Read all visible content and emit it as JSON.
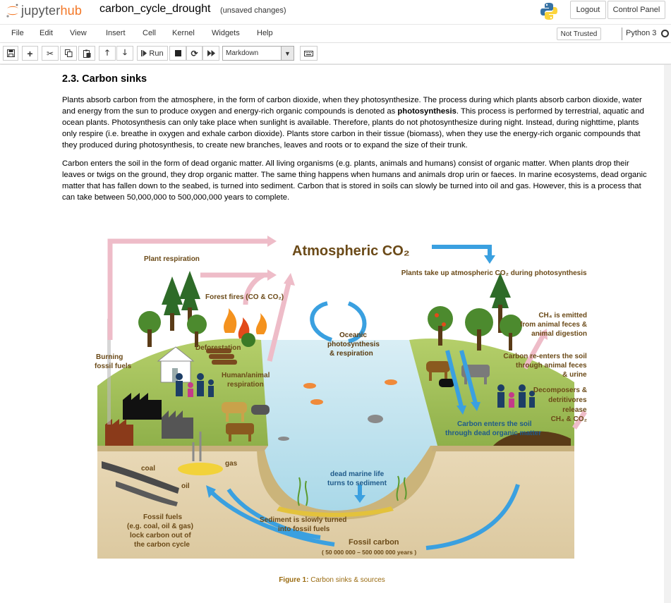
{
  "header": {
    "logo_prefix": "jupyter",
    "logo_suffix": "hub",
    "notebook_title": "carbon_cycle_drought",
    "save_status": "(unsaved changes)",
    "logout_label": "Logout",
    "control_panel_label": "Control Panel"
  },
  "menubar": {
    "items": [
      "File",
      "Edit",
      "View",
      "Insert",
      "Cell",
      "Kernel",
      "Widgets",
      "Help"
    ],
    "trust_label": "Not Trusted",
    "kernel_name": "Python 3"
  },
  "toolbar": {
    "run_label": "Run",
    "cell_type": "Markdown",
    "buttons": [
      "save-icon",
      "plus-icon",
      "cut-icon",
      "copy-icon",
      "paste-icon",
      "arrow-up-icon",
      "arrow-down-icon",
      "step-forward-icon",
      "stop-icon",
      "restart-icon",
      "fast-forward-icon",
      "keyboard-icon"
    ]
  },
  "content": {
    "heading": "2.3. Carbon sinks",
    "para1_a": "Plants absorb carbon from the atmosphere, in the form of carbon dioxide, when they photosynthesize. The process during which plants absorb carbon dioxide, water and energy from the sun to produce oxygen and energy-rich organic compounds is denoted as ",
    "para1_bold": "photosynthesis",
    "para1_b": ". This process is performed by terrestrial, aquatic and ocean plants. Photosynthesis can only take place when sunlight is available. Therefore, plants do not photosynthesize during night. Instead, during nighttime, plants only respire (i.e. breathe in oxygen and exhale carbon dioxide). Plants store carbon in their tissue (biomass), when they use the energy-rich organic compounds that they produced during photosynthesis, to create new branches, leaves and roots or to expand the size of their trunk.",
    "para2": "Carbon enters the soil in the form of dead organic matter. All living organisms (e.g. plants, animals and humans) consist of organic matter. When plants drop their leaves or twigs on the ground, they drop organic matter. The same thing happens when humans and animals drop urin or faeces. In marine ecosystems, dead organic matter that has fallen down to the seabed, is turned into sediment. Carbon that is stored in soils can slowly be turned into oil and gas. However, this is a process that can take between 50,000,000 to 500,000,000 years to complete.",
    "caption_label": "Figure 1:",
    "caption_text": " Carbon sinks & sources"
  },
  "figure": {
    "atmospheric": "Atmospheric CO₂",
    "plant_respiration": "Plant respiration",
    "uptake": "Plants take up atmospheric CO₂ during photosynthesis",
    "forest_fires": "Forest fires (CO & CO₂)",
    "burning_1": "Burning",
    "burning_2": "fossil fuels",
    "deforestation": "Deforestation",
    "human_resp_1": "Human/animal",
    "human_resp_2": "respiration",
    "oceanic_1": "Oceanic",
    "oceanic_2": "photosynthesis",
    "oceanic_3": "& respiration",
    "ch4_1": "CH₄ is emitted",
    "ch4_2": "from animal feces &",
    "ch4_3": "animal digestion",
    "reenter_1": "Carbon re-enters the soil",
    "reenter_2": "through animal feces",
    "reenter_3": "& urine",
    "decomp_1": "Decomposers &",
    "decomp_2": "detritivores",
    "decomp_3": "release",
    "decomp_4": "CH₄ & CO₂",
    "soil_1": "Carbon enters the soil",
    "soil_2": "through dead organic matter",
    "coal": "coal",
    "gas": "gas",
    "oil": "oil",
    "marine_1": "dead marine life",
    "marine_2": "turns to sediment",
    "sediment_1": "Sediment is slowly turned",
    "sediment_2": "into fossil fuels",
    "fossil_1": "Fossil fuels",
    "fossil_2": "(e.g. coal, oil & gas)",
    "fossil_3": "lock carbon out  of",
    "fossil_4": "the carbon cycle",
    "fossil_carbon": "Fossil carbon",
    "fossil_years": "( 50 000 000 – 500 000 000 years )"
  }
}
